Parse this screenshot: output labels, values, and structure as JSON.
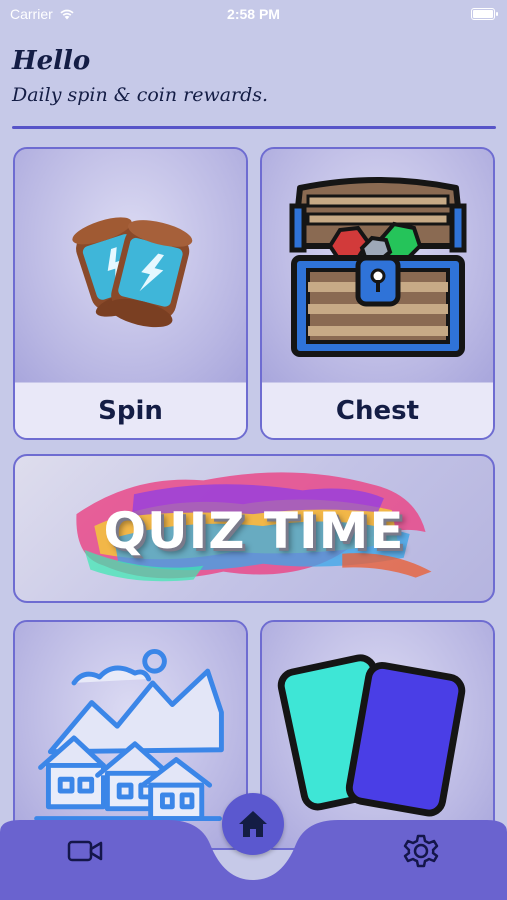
{
  "status_bar": {
    "carrier": "Carrier",
    "time": "2:58 PM",
    "battery_level": 1.0
  },
  "header": {
    "greeting": "Hello",
    "subtitle": "Daily spin & coin rewards."
  },
  "cards": {
    "spin": {
      "label": "Spin",
      "icon": "spin-tokens-icon"
    },
    "chest": {
      "label": "Chest",
      "icon": "treasure-chest-icon"
    },
    "quiz": {
      "banner": "QUIZ TIME"
    },
    "map": {
      "icon": "village-map-icon"
    },
    "cards": {
      "icon": "playing-cards-icon"
    }
  },
  "bottom_nav": {
    "left_icon": "video-camera-icon",
    "center_icon": "home-icon",
    "right_icon": "gear-icon"
  },
  "colors": {
    "background": "#c6c9e8",
    "accent": "#5b58cf",
    "text": "#141d45",
    "card_border": "#6e6cd1"
  }
}
